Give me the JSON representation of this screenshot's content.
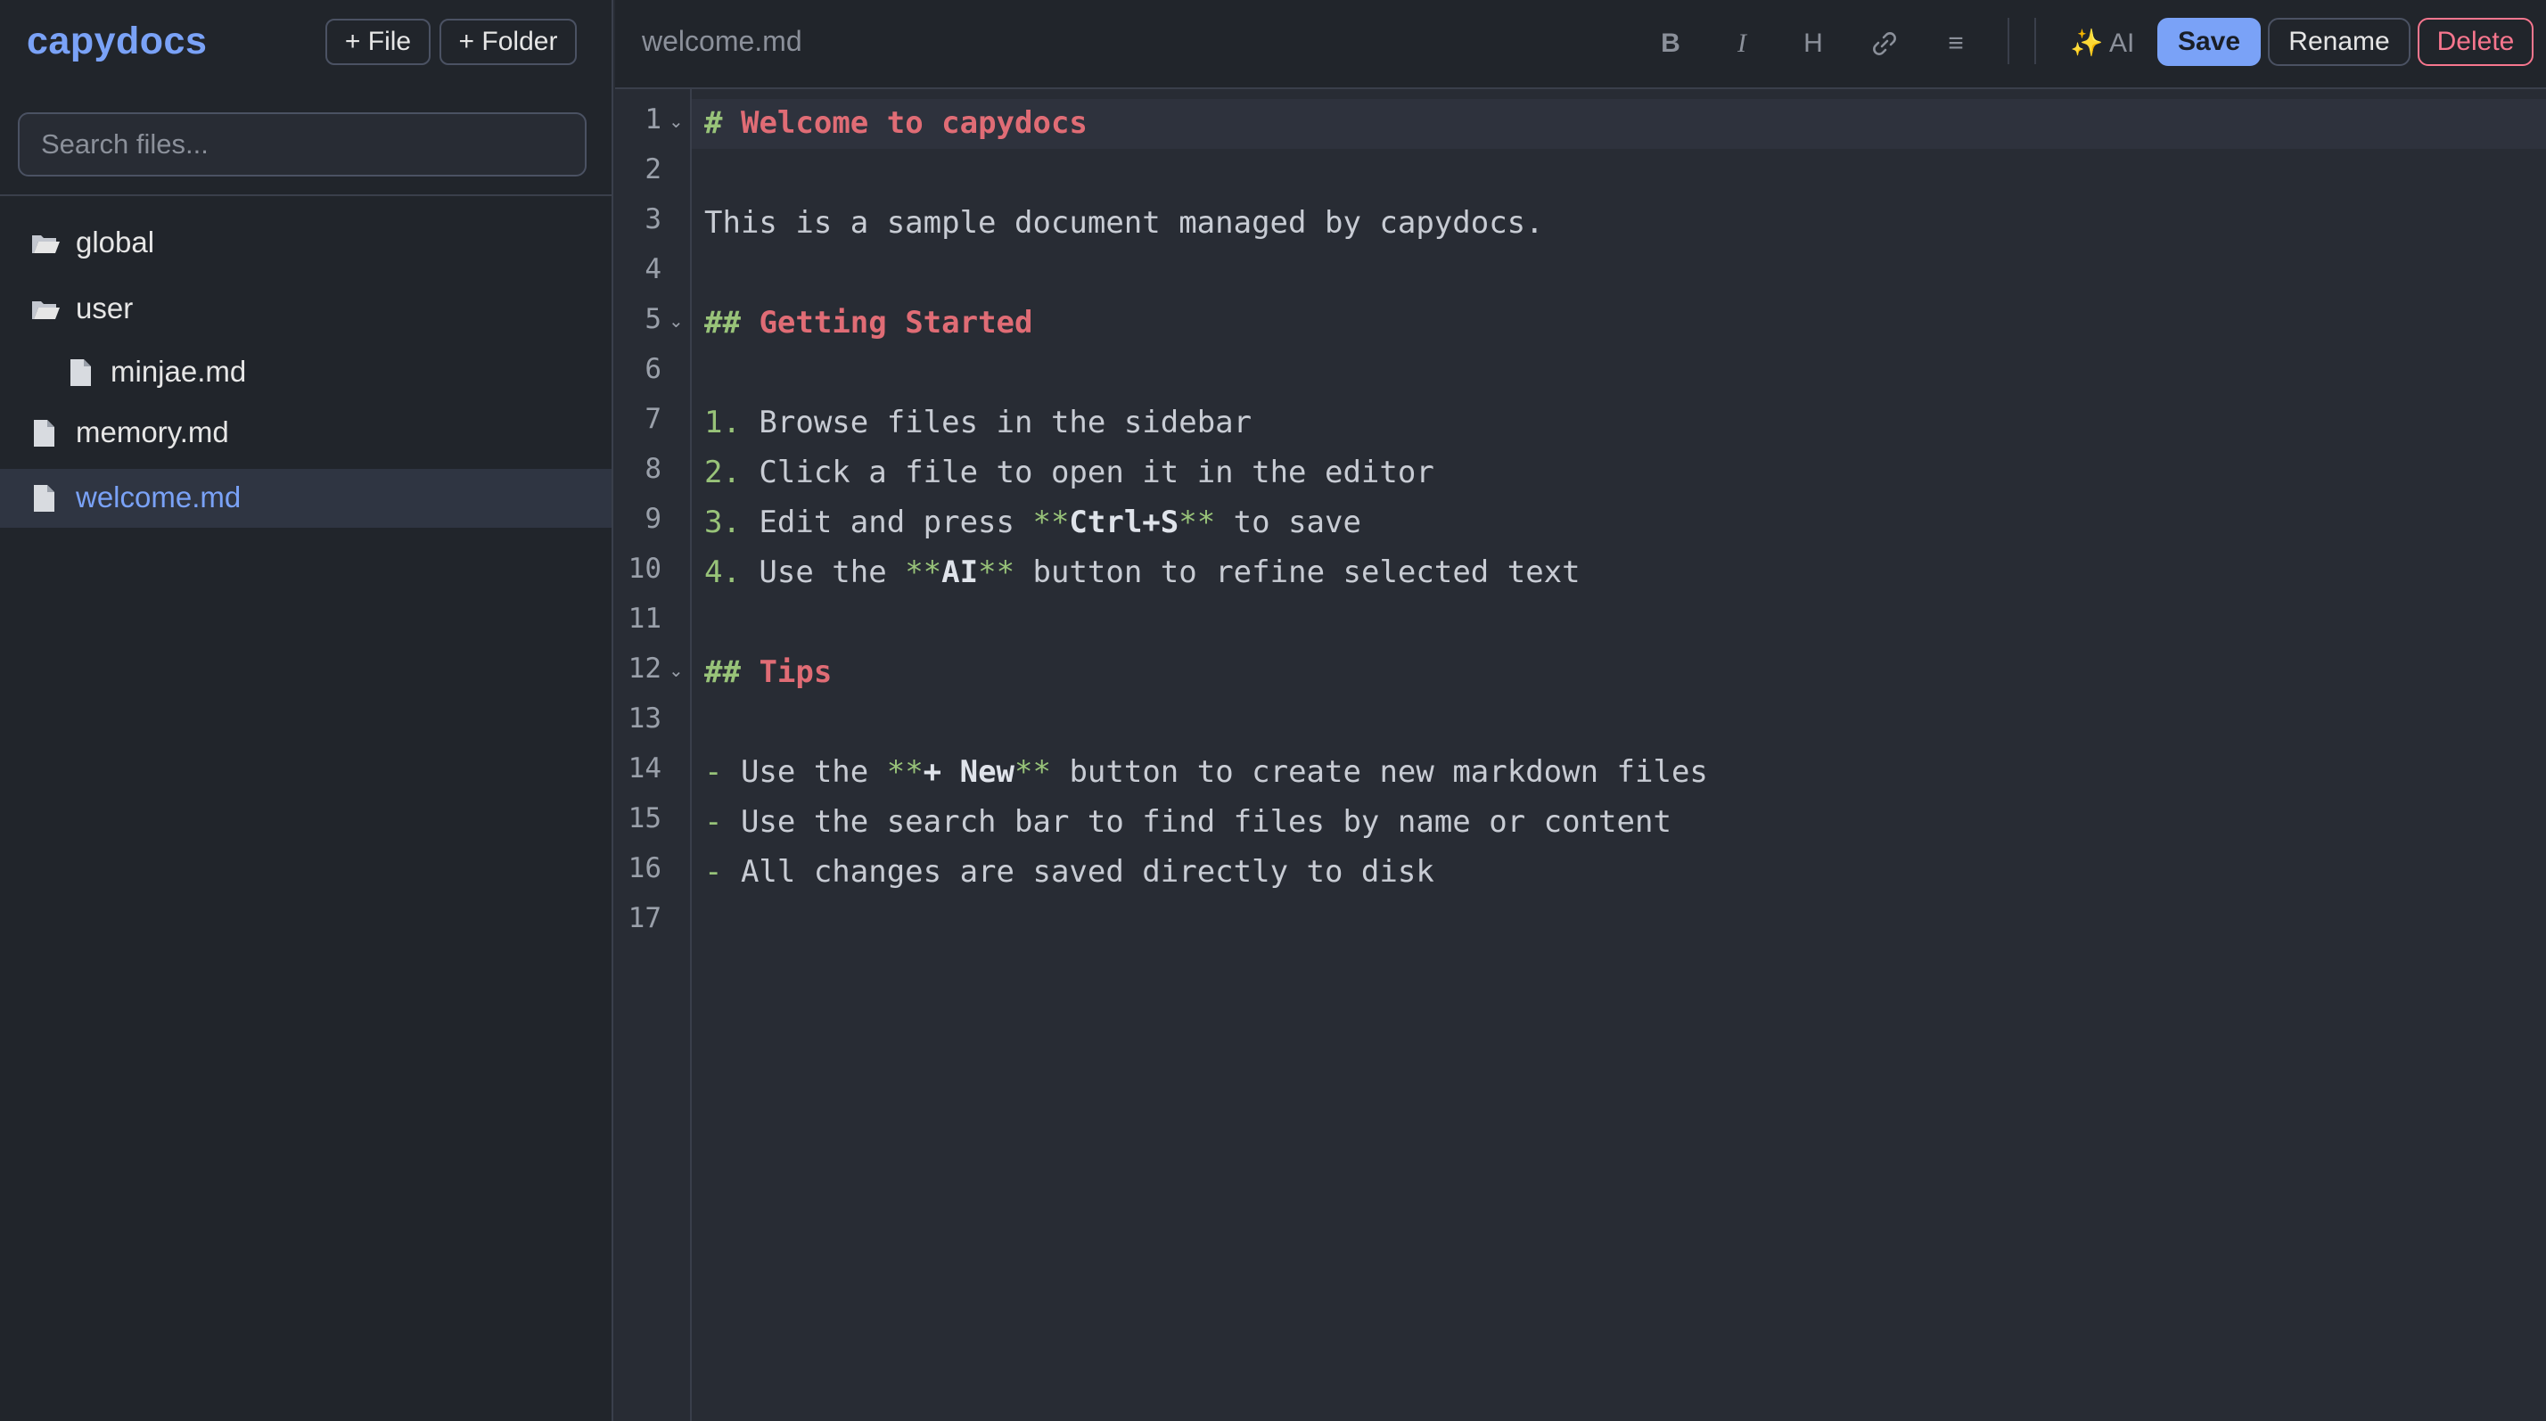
{
  "app": {
    "name": "capydocs"
  },
  "sidebar": {
    "new_file_label": "+ File",
    "new_folder_label": "+ Folder",
    "search_placeholder": "Search files...",
    "tree": [
      {
        "type": "folder",
        "label": "global"
      },
      {
        "type": "folder",
        "label": "user"
      },
      {
        "type": "file",
        "label": "minjae.md",
        "indent": 1
      },
      {
        "type": "file",
        "label": "memory.md"
      },
      {
        "type": "file",
        "label": "welcome.md",
        "active": true
      }
    ]
  },
  "toolbar": {
    "filename": "welcome.md",
    "bold_label": "B",
    "italic_label": "I",
    "heading_label": "H",
    "link_icon": "link-icon",
    "list_label": "≡",
    "ai_label": "✨ AI",
    "save_label": "Save",
    "rename_label": "Rename",
    "delete_label": "Delete"
  },
  "editor": {
    "current_line": 1,
    "line_numbers": [
      "1",
      "2",
      "3",
      "4",
      "5",
      "6",
      "7",
      "8",
      "9",
      "10",
      "11",
      "12",
      "13",
      "14",
      "15",
      "16",
      "17"
    ],
    "fold_lines": [
      1,
      5,
      12
    ],
    "lines": [
      "# Welcome to capydocs",
      "",
      "This is a sample document managed by capydocs.",
      "",
      "## Getting Started",
      "",
      "1. Browse files in the sidebar",
      "2. Click a file to open it in the editor",
      "3. Edit and press **Ctrl+S** to save",
      "4. Use the **AI** button to refine selected text",
      "",
      "## Tips",
      "",
      "- Use the **+ New** button to create new markdown files",
      "- Use the search bar to find files by name or content",
      "- All changes are saved directly to disk",
      ""
    ]
  },
  "colors": {
    "accent": "#7aa2f7",
    "heading": "#e06c75",
    "markup": "#98c379",
    "danger": "#f7768e",
    "background": "#282c34",
    "panel": "#21252b"
  }
}
